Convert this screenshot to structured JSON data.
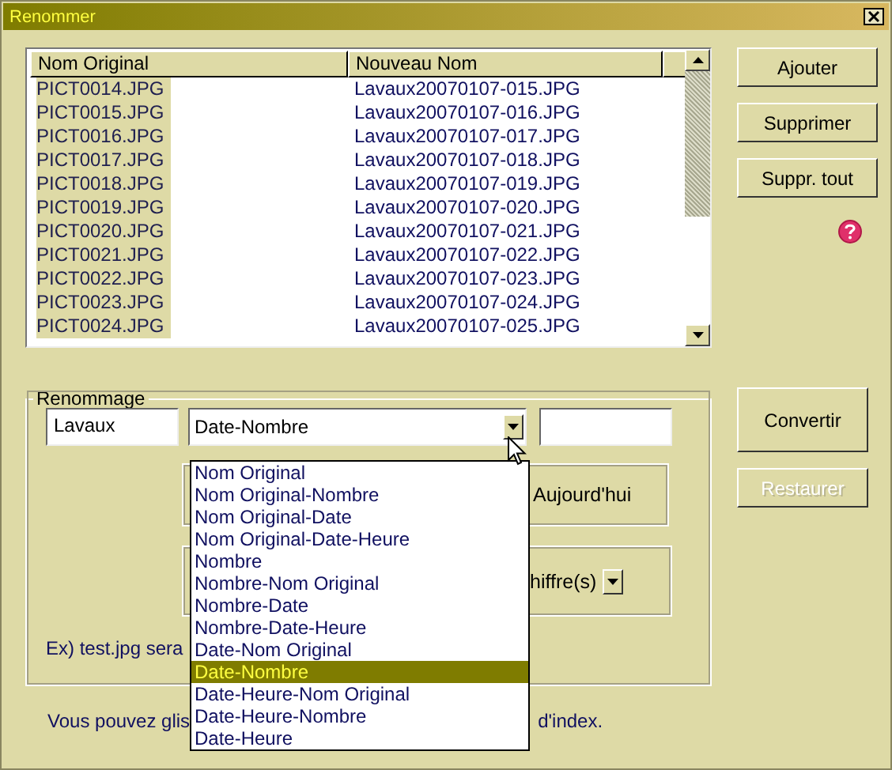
{
  "window": {
    "title": "Renommer"
  },
  "table": {
    "columns": [
      "Nom Original",
      "Nouveau Nom"
    ],
    "rows": [
      {
        "original": "PICT0014.JPG",
        "new": "Lavaux20070107-015.JPG"
      },
      {
        "original": "PICT0015.JPG",
        "new": "Lavaux20070107-016.JPG"
      },
      {
        "original": "PICT0016.JPG",
        "new": "Lavaux20070107-017.JPG"
      },
      {
        "original": "PICT0017.JPG",
        "new": "Lavaux20070107-018.JPG"
      },
      {
        "original": "PICT0018.JPG",
        "new": "Lavaux20070107-019.JPG"
      },
      {
        "original": "PICT0019.JPG",
        "new": "Lavaux20070107-020.JPG"
      },
      {
        "original": "PICT0020.JPG",
        "new": "Lavaux20070107-021.JPG"
      },
      {
        "original": "PICT0021.JPG",
        "new": "Lavaux20070107-022.JPG"
      },
      {
        "original": "PICT0022.JPG",
        "new": "Lavaux20070107-023.JPG"
      },
      {
        "original": "PICT0023.JPG",
        "new": "Lavaux20070107-024.JPG"
      },
      {
        "original": "PICT0024.JPG",
        "new": "Lavaux20070107-025.JPG"
      }
    ]
  },
  "list_buttons": [
    {
      "label": "Ajouter",
      "disabled": false
    },
    {
      "label": "Supprimer",
      "disabled": false
    },
    {
      "label": "Suppr. tout",
      "disabled": false
    }
  ],
  "renaming": {
    "title": "Renommage",
    "prefix": "Lavaux",
    "pattern": "Date-Nombre",
    "options": [
      {
        "label": "Nom Original",
        "selected": false
      },
      {
        "label": "Nom Original-Nombre",
        "selected": false
      },
      {
        "label": "Nom Original-Date",
        "selected": false
      },
      {
        "label": "Nom Original-Date-Heure",
        "selected": false
      },
      {
        "label": "Nombre",
        "selected": false
      },
      {
        "label": "Nombre-Nom Original",
        "selected": false
      },
      {
        "label": "Nombre-Date",
        "selected": false
      },
      {
        "label": "Nombre-Date-Heure",
        "selected": false
      },
      {
        "label": "Date-Nom Original",
        "selected": false
      },
      {
        "label": "Date-Nombre",
        "selected": true
      },
      {
        "label": "Date-Heure-Nom Original",
        "selected": false
      },
      {
        "label": "Date-Heure-Nombre",
        "selected": false
      },
      {
        "label": "Date-Heure",
        "selected": false
      }
    ],
    "date_option": "Aujourd'hui",
    "digits": "hiffre(s)",
    "example": "Ex) test.jpg sera"
  },
  "action_buttons": [
    {
      "label": "Convertir",
      "disabled": false
    },
    {
      "label": "Restaurer",
      "disabled": true
    }
  ],
  "hint": [
    "Vous pouvez glis",
    "d'index."
  ]
}
